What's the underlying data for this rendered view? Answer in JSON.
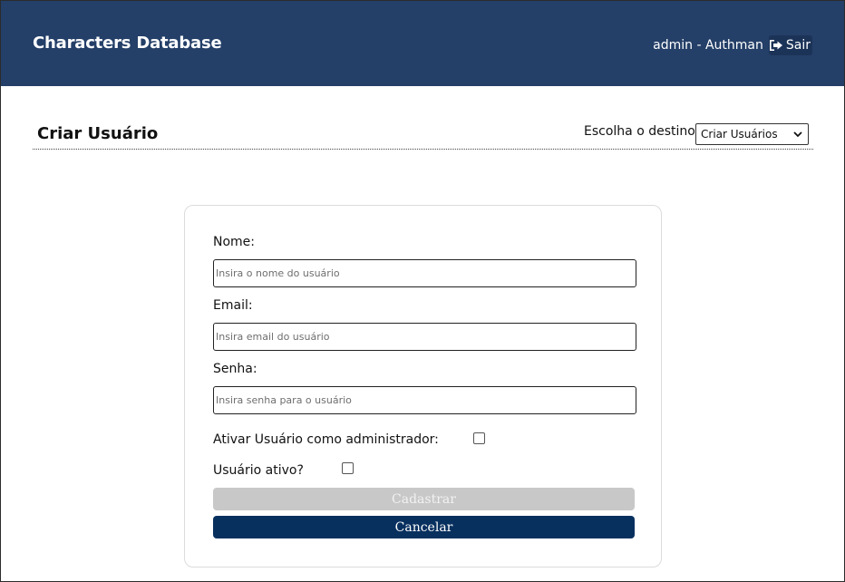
{
  "header": {
    "brand": "Characters Database",
    "user_label": "admin - Authman",
    "logout_label": "Sair",
    "logout_icon": "sign-out-icon"
  },
  "section": {
    "title": "Criar Usuário",
    "destination_label": "Escolha o destino",
    "destination_selected": "Criar Usuários"
  },
  "form": {
    "name_label": "Nome:",
    "name_placeholder": "Insira o nome do usuário",
    "email_label": "Email:",
    "email_placeholder": "Insira email do usuário",
    "password_label": "Senha:",
    "password_placeholder": "Insira senha para o usuário",
    "admin_label": "Ativar Usuário como administrador:",
    "admin_checked": false,
    "active_label": "Usuário ativo?",
    "active_checked": false,
    "submit_label": "Cadastrar",
    "cancel_label": "Cancelar"
  },
  "colors": {
    "header_bg": "#243f68",
    "primary_button": "#08305f",
    "disabled_button": "#c8c8c8"
  }
}
